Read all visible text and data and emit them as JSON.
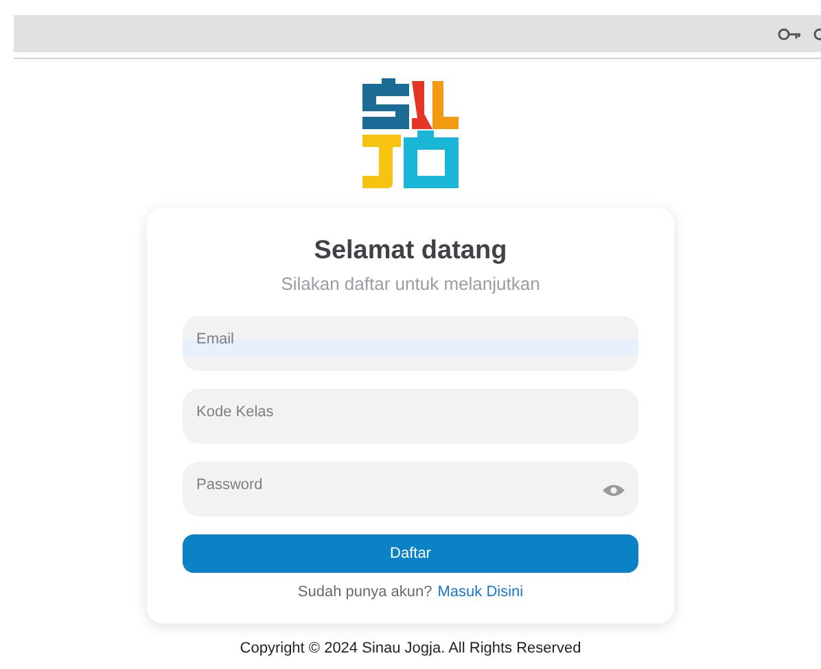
{
  "title": "Selamat datang",
  "subtitle": "Silakan daftar untuk melanjutkan",
  "fields": [
    {
      "kind": "text",
      "placeholder": "Email",
      "highlighted": true
    },
    {
      "kind": "text",
      "placeholder": "Kode Kelas",
      "highlighted": false
    },
    {
      "kind": "password",
      "placeholder": "Password",
      "highlighted": false
    }
  ],
  "submit": "Daftar",
  "login_prompt": "Sudah punya akun?",
  "login_link": "Masuk Disini",
  "footer": "Copyright © 2024 Sinau Jogja. All Rights Reserved"
}
